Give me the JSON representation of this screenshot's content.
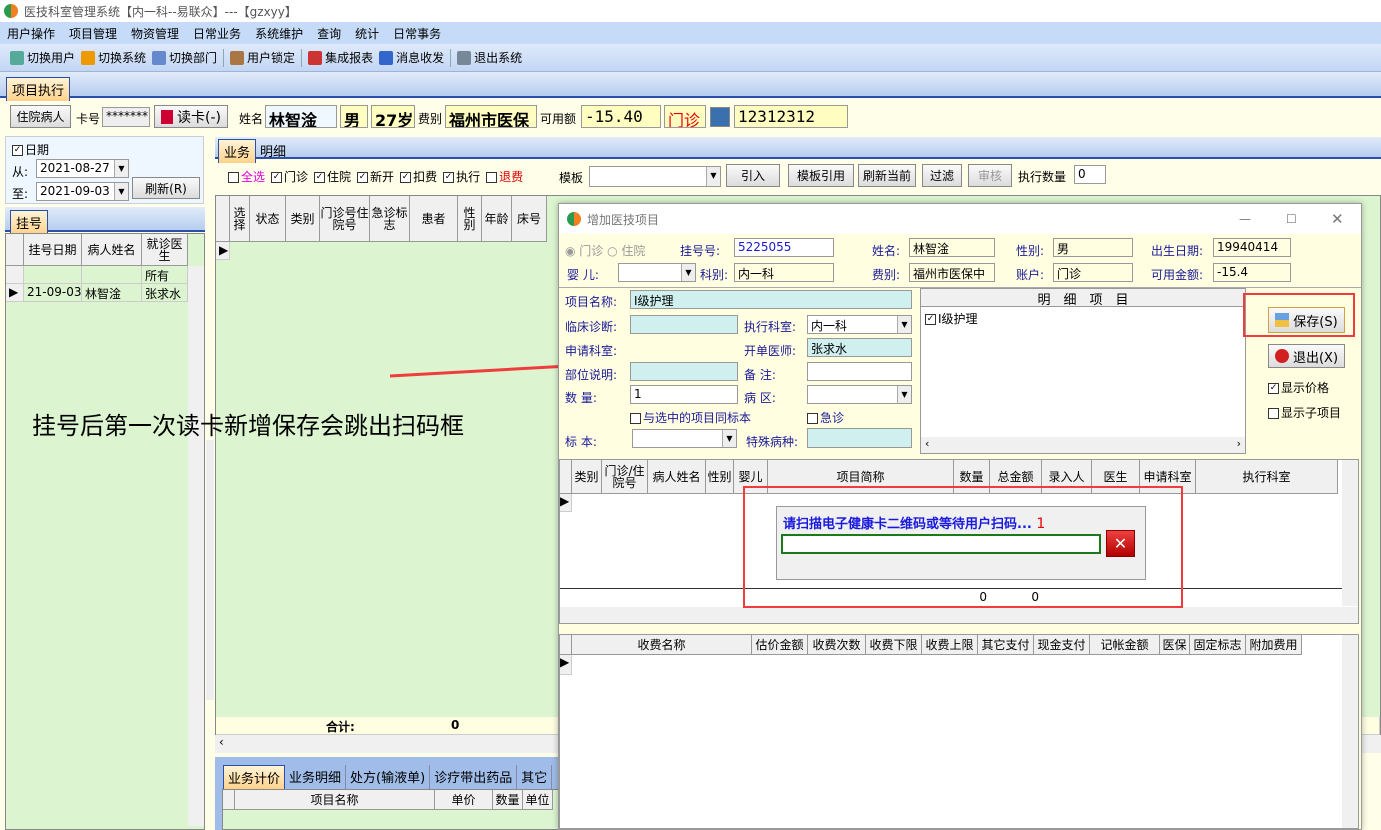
{
  "window": {
    "title": "医技科室管理系统【内一科--易联众】---【gzxyy】"
  },
  "menu": [
    "用户操作",
    "项目管理",
    "物资管理",
    "日常业务",
    "系统维护",
    "查询",
    "统计",
    "日常事务"
  ],
  "toolbar": [
    "切换用户",
    "切换系统",
    "切换部门",
    "用户锁定",
    "集成报表",
    "消息收发",
    "退出系统"
  ],
  "main_tab": "项目执行",
  "patient": {
    "inpatient_btn": "住院病人",
    "card_label": "卡号",
    "card_value": "*******",
    "read_card": "读卡(-)",
    "name_label": "姓名",
    "name": "林智淦",
    "gender": "男",
    "age": "27岁",
    "fee_label": "费别",
    "fee_type": "福州市医保",
    "balance_label": "可用额",
    "balance": "-15.40",
    "visit_type": "门诊",
    "card_no": "12312312"
  },
  "filter": {
    "date_label": "日期",
    "from_label": "从:",
    "from": "2021-08-27",
    "to_label": "至:",
    "to": "2021-09-03",
    "refresh": "刷新(R)"
  },
  "reg": {
    "tab": "挂号",
    "headers": [
      "挂号日期",
      "病人姓名",
      "就诊医生"
    ],
    "rows": [
      [
        "",
        "",
        "所有"
      ],
      [
        "21-09-03",
        "林智淦",
        "张求水"
      ]
    ]
  },
  "biz": {
    "tabs": [
      "业务",
      "明细"
    ],
    "checks": [
      {
        "label": "全选",
        "checked": false,
        "color": "#e000e0"
      },
      {
        "label": "门诊",
        "checked": true
      },
      {
        "label": "住院",
        "checked": true
      },
      {
        "label": "新开",
        "checked": true
      },
      {
        "label": "扣费",
        "checked": true
      },
      {
        "label": "执行",
        "checked": true
      },
      {
        "label": "退费",
        "checked": false,
        "color": "#e00000"
      }
    ],
    "template_label": "模板",
    "buttons": [
      "引入",
      "模板引用",
      "刷新当前",
      "过滤",
      "审核"
    ],
    "exec_qty_label": "执行数量",
    "exec_qty": "0",
    "headers": [
      "选择",
      "状态",
      "类别",
      "门诊号住院号",
      "急诊标志",
      "患者",
      "性别",
      "年龄",
      "床号"
    ],
    "total_label": "合计:",
    "total_value": "0"
  },
  "bottom": {
    "tabs": [
      "业务计价",
      "业务明细",
      "处方(输液单)",
      "诊疗带出药品",
      "其它"
    ],
    "headers": [
      "项目名称",
      "单价",
      "数量",
      "单位"
    ]
  },
  "dialog": {
    "title": "增加医技项目",
    "radio": [
      "门诊",
      "住院"
    ],
    "reg_no_label": "挂号号:",
    "reg_no": "5225055",
    "name_label": "姓名:",
    "name": "林智淦",
    "gender_label": "性别:",
    "gender": "男",
    "birth_label": "出生日期:",
    "birth": "19940414",
    "baby_label": "婴  儿:",
    "dept_label": "科别:",
    "dept": "内一科",
    "fee_label": "费别:",
    "fee": "福州市医保中",
    "account_label": "账户:",
    "account": "门诊",
    "avail_label": "可用金额:",
    "avail": "-15.4",
    "item_name_label": "项目名称:",
    "item_name": "Ⅰ级护理",
    "diag_label": "临床诊断:",
    "exec_dept_label": "执行科室:",
    "exec_dept": "内一科",
    "req_dept_label": "申请科室:",
    "doctor_label": "开单医师:",
    "doctor": "张求水",
    "part_label": "部位说明:",
    "remark_label": "备    注:",
    "qty_label": "数    量:",
    "qty": "1",
    "ward_label": "病    区:",
    "same_spec": "与选中的项目同标本",
    "emergency": "急诊",
    "spec_label": "标    本:",
    "special_label": "特殊病种:",
    "detail_header": "明　细　项　目",
    "detail_items": [
      {
        "label": "Ⅰ级护理",
        "checked": true
      }
    ],
    "save": "保存(S)",
    "exit": "退出(X)",
    "show_price": "显示价格",
    "show_price_checked": true,
    "show_sub": "显示子项目",
    "show_sub_checked": false,
    "grid_headers": [
      "类别",
      "门诊/住院号",
      "病人姓名",
      "性别",
      "婴儿",
      "项目简称",
      "数量",
      "总金额",
      "录入人",
      "医生",
      "申请科室",
      "执行科室"
    ],
    "grid_totals": [
      "0",
      "0"
    ],
    "fee_headers": [
      "收费名称",
      "估价金额",
      "收费次数",
      "收费下限",
      "收费上限",
      "其它支付",
      "现金支付",
      "记帐金额",
      "医保",
      "固定标志",
      "附加费用"
    ]
  },
  "scan": {
    "prompt": "请扫描电子健康卡二维码或等待用户扫码...",
    "count": "1",
    "input": ""
  },
  "annotation": {
    "text": "挂号后第一次读卡新增保存会跳出扫码框",
    "color": "#f03c3c"
  }
}
